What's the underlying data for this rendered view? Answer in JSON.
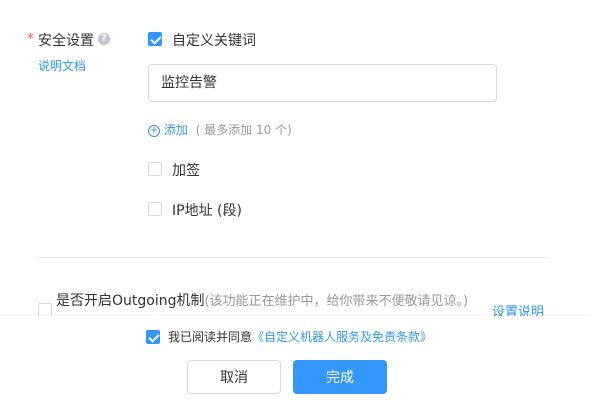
{
  "security": {
    "required_mark": "*",
    "label": "安全设置",
    "help_icon": "question-circle-icon",
    "doc_link": "说明文档"
  },
  "custom_keyword": {
    "checked": true,
    "label": "自定义关键词",
    "value": "监控告警",
    "add_label": "添加",
    "add_hint": "( 最多添加 10 个)"
  },
  "sign": {
    "checked": false,
    "label": "加签"
  },
  "ip": {
    "checked": false,
    "label": "IP地址 (段)"
  },
  "outgoing": {
    "checked": false,
    "label": "是否开启Outgoing机制",
    "hint": "(该功能正在维护中，给你带来不便敬请见谅。)",
    "settings_link": "设置说明"
  },
  "agreement": {
    "checked": true,
    "text": "我已阅读并同意",
    "link": "《自定义机器人服务及免责条款》"
  },
  "buttons": {
    "cancel": "取消",
    "finish": "完成"
  },
  "colors": {
    "accent": "#3296fa",
    "required": "#f25643"
  }
}
